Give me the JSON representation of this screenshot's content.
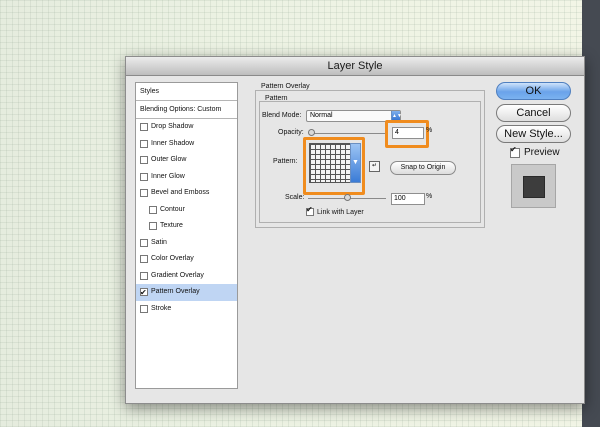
{
  "dialog": {
    "title": "Layer Style"
  },
  "left_panel": {
    "styles_label": "Styles",
    "blending_label": "Blending Options: Custom",
    "items": [
      {
        "label": "Drop Shadow",
        "checked": false,
        "sub": false,
        "selected": false
      },
      {
        "label": "Inner Shadow",
        "checked": false,
        "sub": false,
        "selected": false
      },
      {
        "label": "Outer Glow",
        "checked": false,
        "sub": false,
        "selected": false
      },
      {
        "label": "Inner Glow",
        "checked": false,
        "sub": false,
        "selected": false
      },
      {
        "label": "Bevel and Emboss",
        "checked": false,
        "sub": false,
        "selected": false
      },
      {
        "label": "Contour",
        "checked": false,
        "sub": true,
        "selected": false
      },
      {
        "label": "Texture",
        "checked": false,
        "sub": true,
        "selected": false
      },
      {
        "label": "Satin",
        "checked": false,
        "sub": false,
        "selected": false
      },
      {
        "label": "Color Overlay",
        "checked": false,
        "sub": false,
        "selected": false
      },
      {
        "label": "Gradient Overlay",
        "checked": false,
        "sub": false,
        "selected": false
      },
      {
        "label": "Pattern Overlay",
        "checked": true,
        "sub": false,
        "selected": true
      },
      {
        "label": "Stroke",
        "checked": false,
        "sub": false,
        "selected": false
      }
    ]
  },
  "pattern_overlay": {
    "group_title": "Pattern Overlay",
    "sub_group_title": "Pattern",
    "blend_mode_label": "Blend Mode:",
    "blend_mode_value": "Normal",
    "opacity_label": "Opacity:",
    "opacity_value": "4",
    "opacity_unit": "%",
    "pattern_label": "Pattern:",
    "snap_button": "Snap to Origin",
    "scale_label": "Scale:",
    "scale_value": "100",
    "scale_unit": "%",
    "link_label": "Link with Layer",
    "link_checked": true
  },
  "actions": {
    "ok": "OK",
    "cancel": "Cancel",
    "new_style": "New Style...",
    "preview_label": "Preview",
    "preview_checked": true
  },
  "colors": {
    "highlight_orange": "#f08c1e",
    "ok_button_blue": "#6aa3ea",
    "selected_row": "#bfd5f3"
  }
}
